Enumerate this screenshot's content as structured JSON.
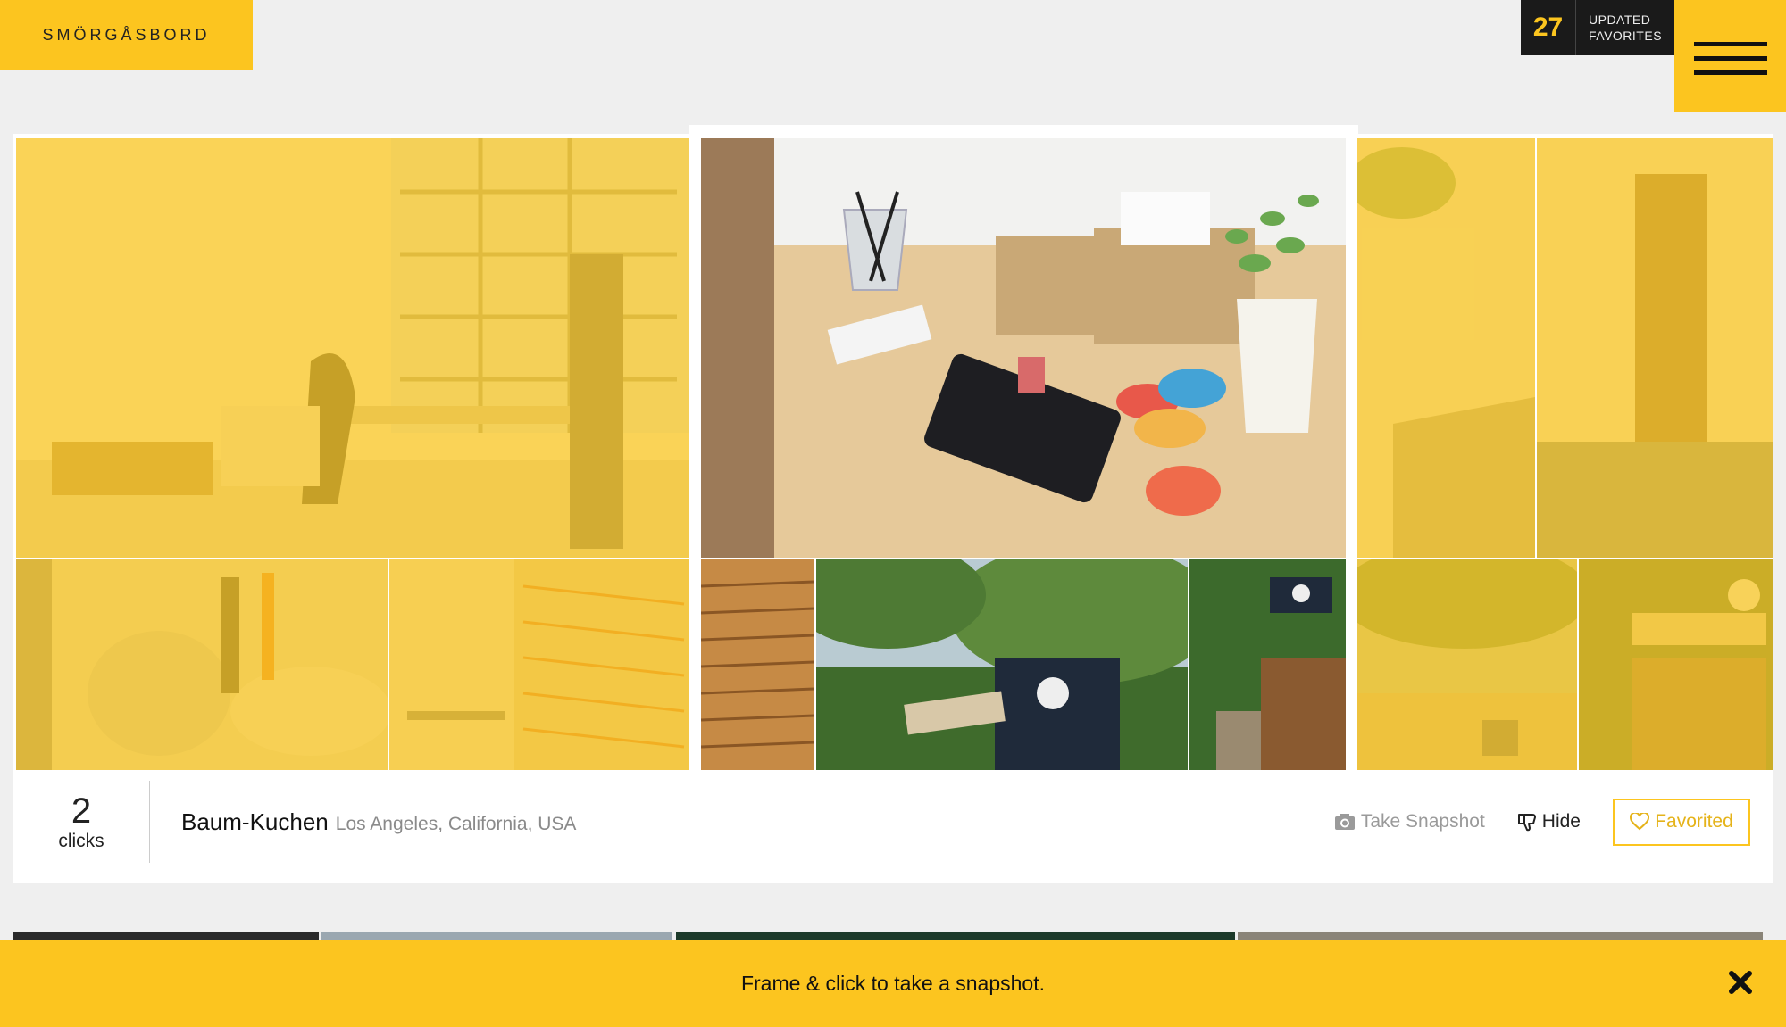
{
  "brand": {
    "logo_text": "SMÖRGÅSBORD"
  },
  "updates": {
    "count": "27",
    "label_line1": "UPDATED",
    "label_line2": "FAVORITES"
  },
  "menu": {
    "icon": "hamburger-icon"
  },
  "card": {
    "clicks": {
      "count": "2",
      "label": "clicks"
    },
    "place": {
      "name": "Baum-Kuchen",
      "location": "Los Angeles, California, USA"
    },
    "actions": {
      "snapshot_label": "Take Snapshot",
      "hide_label": "Hide",
      "favorite_label": "Favorited"
    }
  },
  "banner": {
    "message": "Frame & click to take a snapshot."
  },
  "colors": {
    "accent": "#fcc51f",
    "dark": "#1a1a1a",
    "background": "#efefef"
  }
}
